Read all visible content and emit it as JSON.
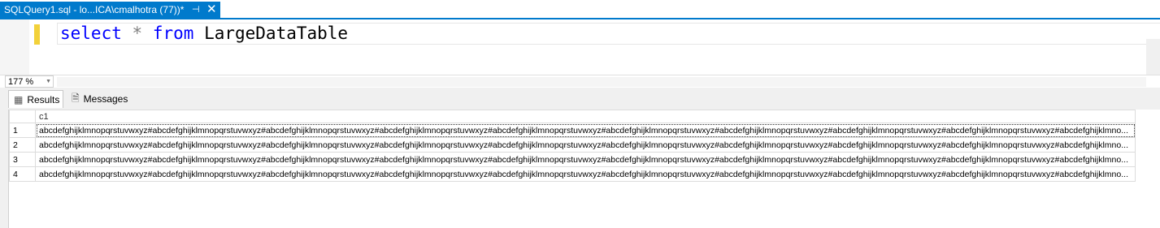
{
  "tab": {
    "title": "SQLQuery1.sql - lo...ICA\\cmalhotra (77))*",
    "pin_icon": "pin-icon",
    "close_icon": "close-icon",
    "accent": "#007acc"
  },
  "editor": {
    "keyword_select": "select",
    "star": "*",
    "keyword_from": "from",
    "table_name": "LargeDataTable",
    "keyword_color": "#0000ff"
  },
  "zoom": {
    "value": "177 %"
  },
  "results": {
    "tabs": [
      {
        "label": "Results",
        "icon": "grid-icon"
      },
      {
        "label": "Messages",
        "icon": "messages-icon"
      }
    ],
    "columns": [
      "c1"
    ],
    "rows": [
      {
        "num": "1",
        "value": "abcdefghijklmnopqrstuvwxyz#abcdefghijklmnopqrstuvwxyz#abcdefghijklmnopqrstuvwxyz#abcdefghijklmnopqrstuvwxyz#abcdefghijklmnopqrstuvwxyz#abcdefghijklmnopqrstuvwxyz#abcdefghijklmnopqrstuvwxyz#abcdefghijklmnopqrstuvwxyz#abcdefghijklmnopqrstuvwxyz#abcdefghijklmno..."
      },
      {
        "num": "2",
        "value": "abcdefghijklmnopqrstuvwxyz#abcdefghijklmnopqrstuvwxyz#abcdefghijklmnopqrstuvwxyz#abcdefghijklmnopqrstuvwxyz#abcdefghijklmnopqrstuvwxyz#abcdefghijklmnopqrstuvwxyz#abcdefghijklmnopqrstuvwxyz#abcdefghijklmnopqrstuvwxyz#abcdefghijklmnopqrstuvwxyz#abcdefghijklmno..."
      },
      {
        "num": "3",
        "value": "abcdefghijklmnopqrstuvwxyz#abcdefghijklmnopqrstuvwxyz#abcdefghijklmnopqrstuvwxyz#abcdefghijklmnopqrstuvwxyz#abcdefghijklmnopqrstuvwxyz#abcdefghijklmnopqrstuvwxyz#abcdefghijklmnopqrstuvwxyz#abcdefghijklmnopqrstuvwxyz#abcdefghijklmnopqrstuvwxyz#abcdefghijklmno..."
      },
      {
        "num": "4",
        "value": "abcdefghijklmnopqrstuvwxyz#abcdefghijklmnopqrstuvwxyz#abcdefghijklmnopqrstuvwxyz#abcdefghijklmnopqrstuvwxyz#abcdefghijklmnopqrstuvwxyz#abcdefghijklmnopqrstuvwxyz#abcdefghijklmnopqrstuvwxyz#abcdefghijklmnopqrstuvwxyz#abcdefghijklmnopqrstuvwxyz#abcdefghijklmno..."
      }
    ]
  }
}
